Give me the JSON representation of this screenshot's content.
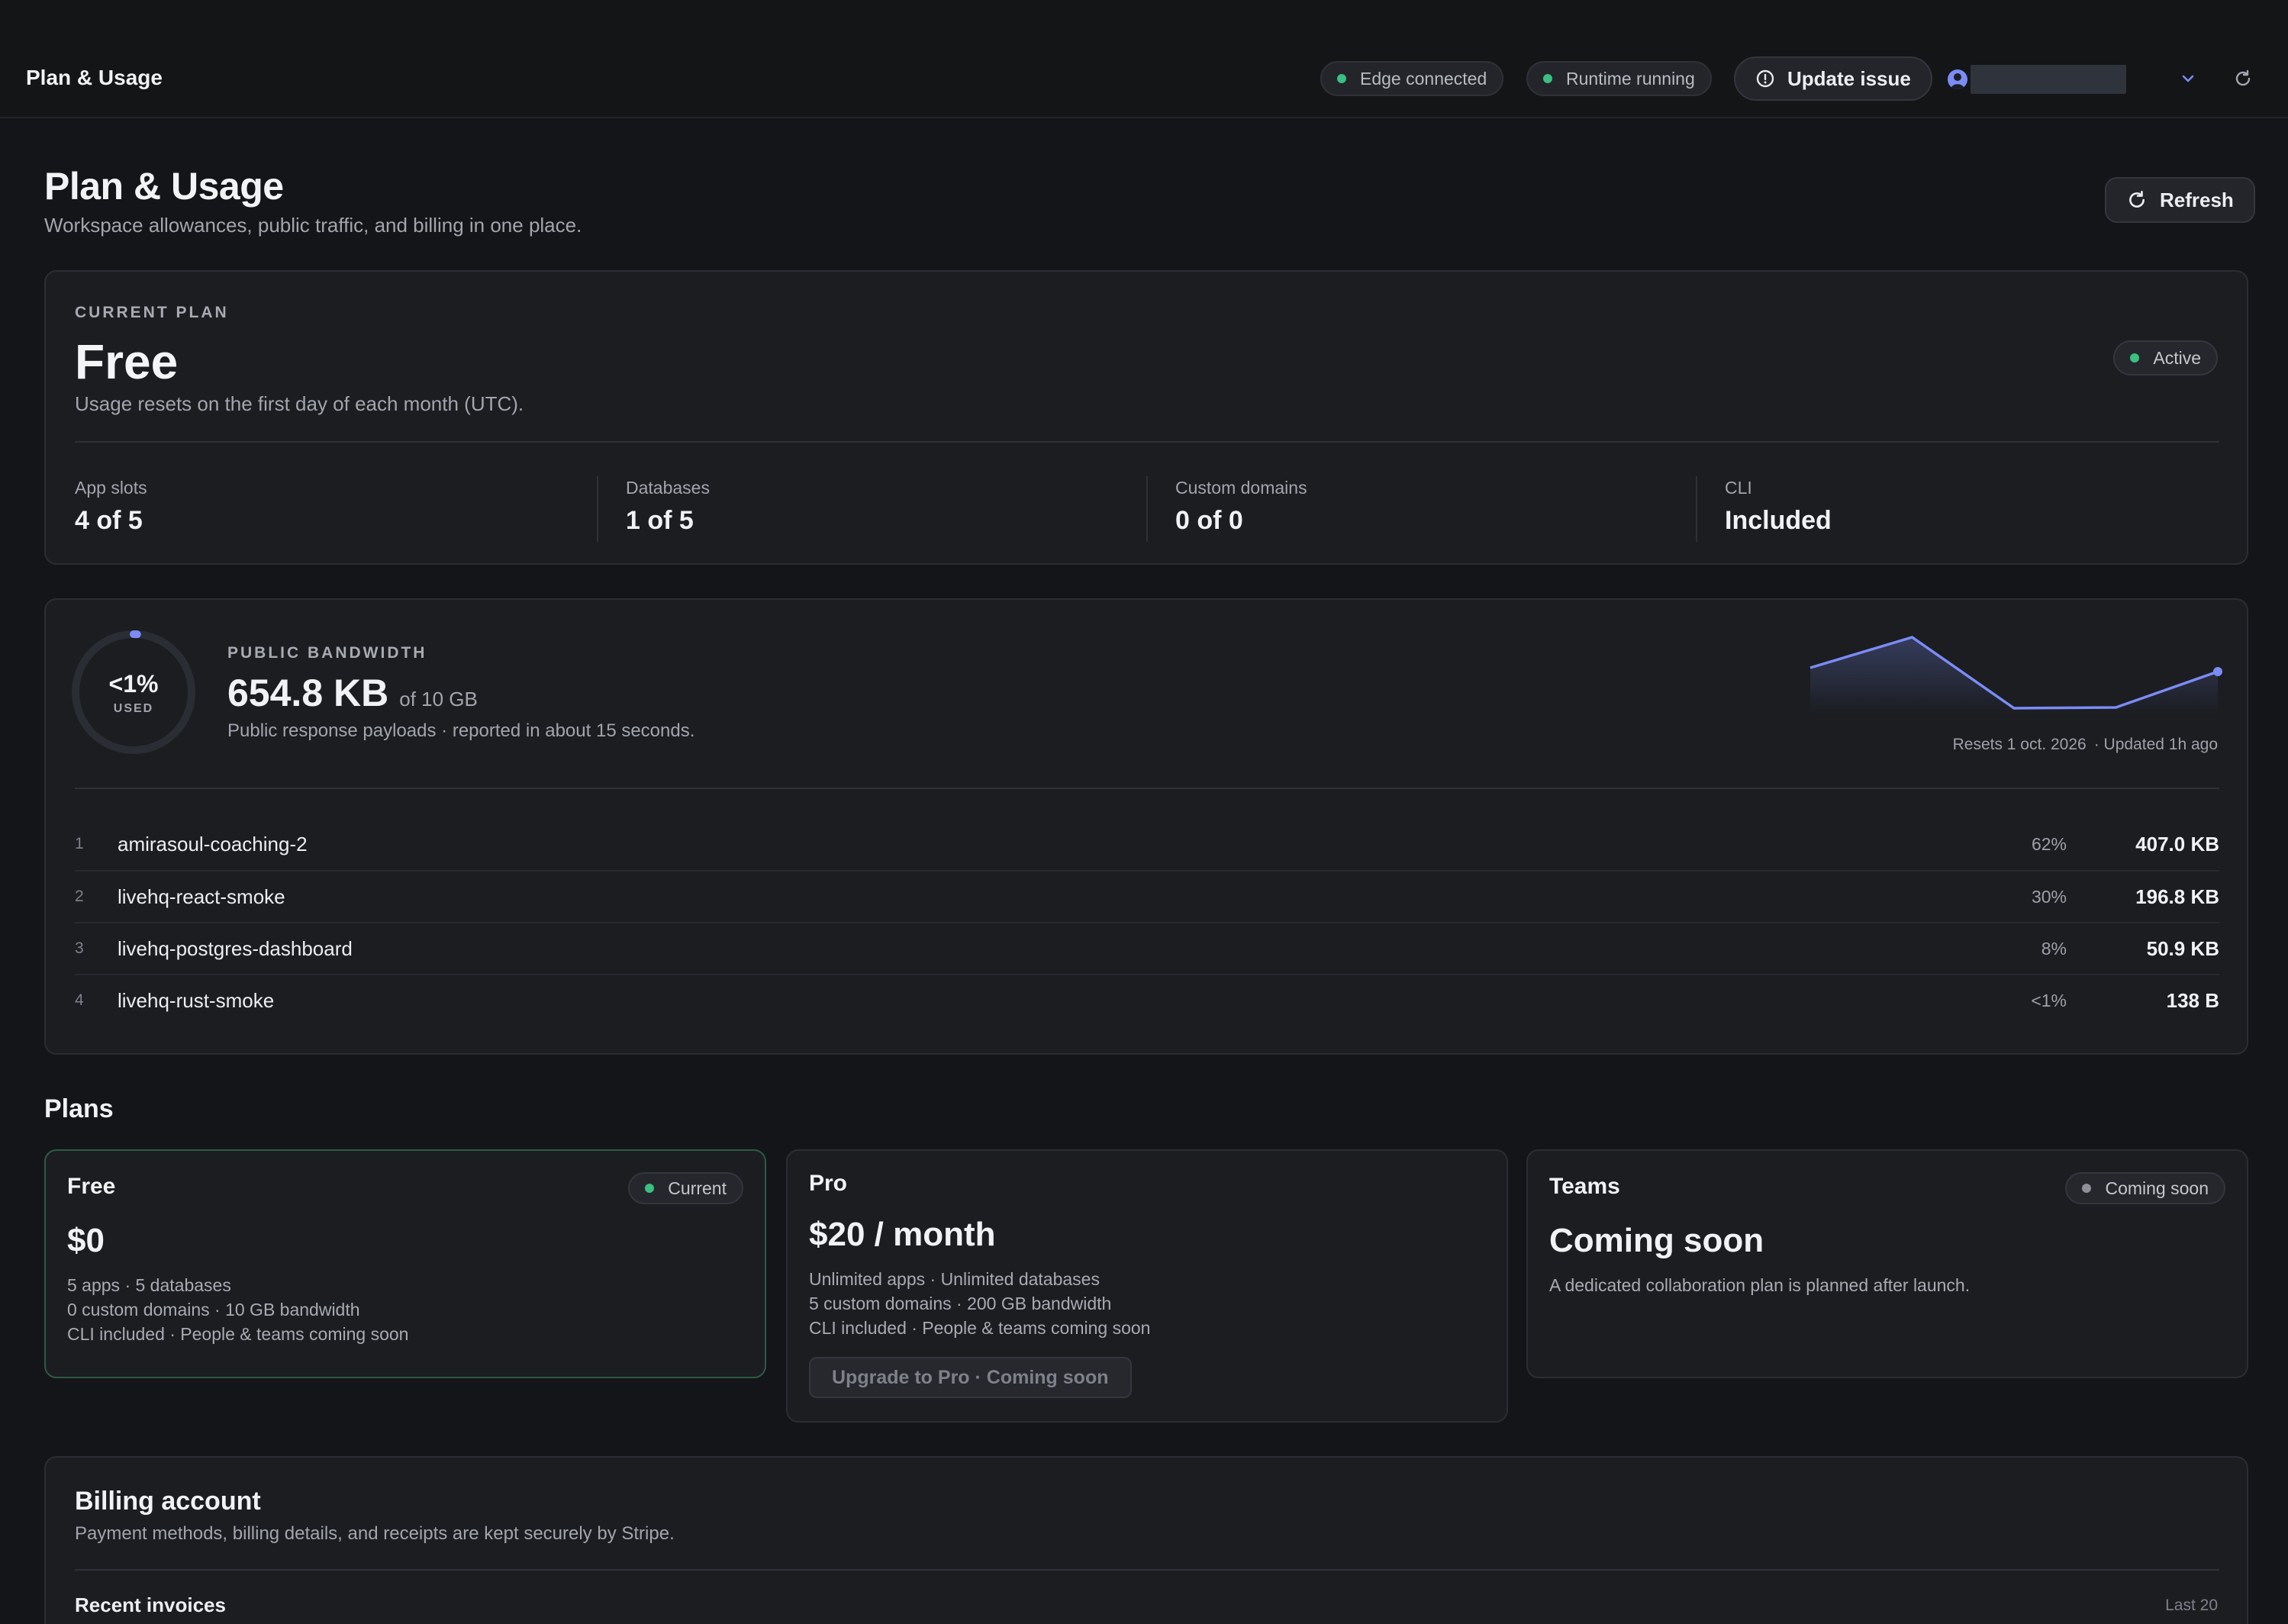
{
  "topbar": {
    "title": "Plan & Usage",
    "edge_status": "Edge connected",
    "runtime_status": "Runtime running",
    "update_button": "Update issue"
  },
  "header": {
    "title": "Plan & Usage",
    "subtitle": "Workspace allowances, public traffic, and billing in one place.",
    "refresh_button": "Refresh"
  },
  "current_plan": {
    "eyebrow": "CURRENT PLAN",
    "name": "Free",
    "note": "Usage resets on the first day of each month (UTC).",
    "status": "Active",
    "stats": [
      {
        "label": "App slots",
        "value": "4 of 5"
      },
      {
        "label": "Databases",
        "value": "1 of 5"
      },
      {
        "label": "Custom domains",
        "value": "0 of 0"
      },
      {
        "label": "CLI",
        "value": "Included"
      }
    ]
  },
  "bandwidth": {
    "ring_value": "<1%",
    "ring_label": "USED",
    "ring_fraction": 0.01,
    "eyebrow": "PUBLIC BANDWIDTH",
    "used": "654.8 KB",
    "of_total": "of 10 GB",
    "note": "Public response payloads · reported in about 15 seconds.",
    "resets": "Resets 1 oct. 2026",
    "updated": "· Updated 1h ago",
    "sparkline": [
      0.55,
      0.95,
      0.02,
      0.03,
      0.5
    ],
    "apps": [
      {
        "rank": "1",
        "name": "amirasoul-coaching-2",
        "pct": "62%",
        "size": "407.0 KB"
      },
      {
        "rank": "2",
        "name": "livehq-react-smoke",
        "pct": "30%",
        "size": "196.8 KB"
      },
      {
        "rank": "3",
        "name": "livehq-postgres-dashboard",
        "pct": "8%",
        "size": "50.9 KB"
      },
      {
        "rank": "4",
        "name": "livehq-rust-smoke",
        "pct": "<1%",
        "size": "138 B"
      }
    ]
  },
  "plans": {
    "heading": "Plans",
    "free": {
      "name": "Free",
      "badge": "Current",
      "price": "$0",
      "features": [
        "5 apps · 5 databases",
        "0 custom domains · 10 GB bandwidth",
        "CLI included · People & teams coming soon"
      ]
    },
    "pro": {
      "name": "Pro",
      "price": "$20 / month",
      "features": [
        "Unlimited apps · Unlimited databases",
        "5 custom domains · 200 GB bandwidth",
        "CLI included · People & teams coming soon"
      ],
      "button": "Upgrade to Pro · Coming soon"
    },
    "teams": {
      "name": "Teams",
      "badge": "Coming soon",
      "price": "Coming soon",
      "features": [
        "A dedicated collaboration plan is planned after launch."
      ]
    }
  },
  "billing": {
    "title": "Billing account",
    "subtitle": "Payment methods, billing details, and receipts are kept securely by Stripe.",
    "invoices_title": "Recent invoices",
    "invoices_meta": "Last 20"
  },
  "colors": {
    "accent": "#7b8cf6",
    "success": "#3bbf82",
    "background": "#141518",
    "card": "#1b1d21"
  }
}
